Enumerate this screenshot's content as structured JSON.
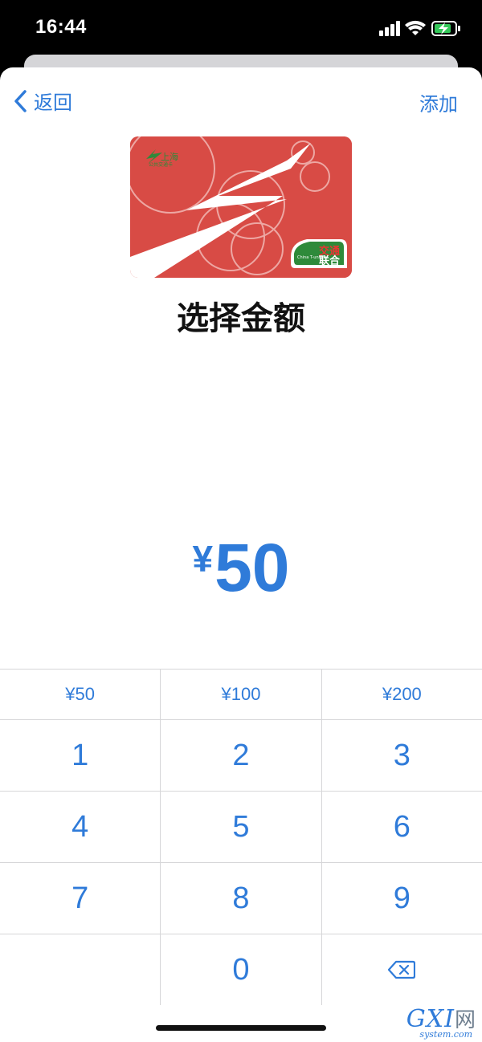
{
  "status_bar": {
    "time": "16:44"
  },
  "nav": {
    "back_label": "返回",
    "add_label": "添加"
  },
  "card": {
    "city_label": "上海",
    "subtitle": "公共交通卡",
    "badge_line1": "交通",
    "badge_line2": "联合",
    "badge_latin": "China T-union"
  },
  "title": "选择金额",
  "amount": {
    "currency": "¥",
    "value": "50"
  },
  "keypad": {
    "quick_amounts": [
      "¥50",
      "¥100",
      "¥200"
    ],
    "keys": [
      "1",
      "2",
      "3",
      "4",
      "5",
      "6",
      "7",
      "8",
      "9",
      "0"
    ]
  },
  "watermark": {
    "main": "GXI",
    "cn": "网",
    "sub": "system.com"
  },
  "colors": {
    "accent": "#2f7bd9",
    "card_red": "#d84b45",
    "card_green": "#2e8a3a"
  }
}
